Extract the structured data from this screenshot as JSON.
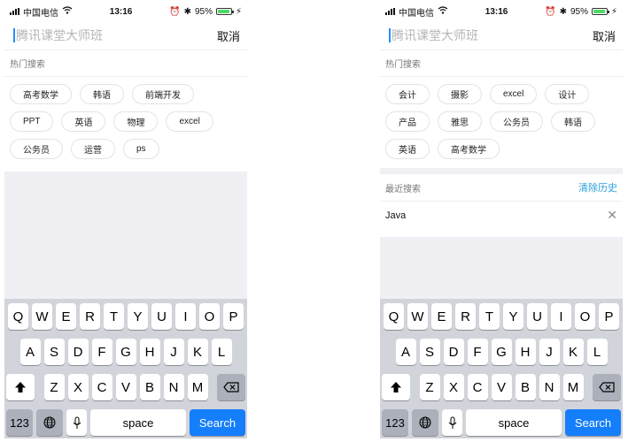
{
  "left": {
    "status": {
      "carrier": "中国电信",
      "time": "13:16",
      "battery": "95%"
    },
    "search": {
      "placeholder": "腾讯课堂大师班",
      "cancel": "取消"
    },
    "hot": {
      "title": "热门搜索",
      "tags": [
        "高考数学",
        "韩语",
        "前端开发",
        "PPT",
        "英语",
        "物理",
        "excel",
        "公务员",
        "运营",
        "ps"
      ]
    },
    "keyboard": {
      "row1": [
        "Q",
        "W",
        "E",
        "R",
        "T",
        "Y",
        "U",
        "I",
        "O",
        "P"
      ],
      "row2": [
        "A",
        "S",
        "D",
        "F",
        "G",
        "H",
        "J",
        "K",
        "L"
      ],
      "row3": [
        "Z",
        "X",
        "C",
        "V",
        "B",
        "N",
        "M"
      ],
      "numbers": "123",
      "space": "space",
      "search": "Search"
    }
  },
  "right": {
    "status": {
      "carrier": "中国电信",
      "time": "13:16",
      "battery": "95%"
    },
    "search": {
      "placeholder": "腾讯课堂大师班",
      "cancel": "取消"
    },
    "hot": {
      "title": "热门搜索",
      "tags": [
        "会计",
        "摄影",
        "excel",
        "设计",
        "产品",
        "雅思",
        "公务员",
        "韩语",
        "英语",
        "高考数学"
      ]
    },
    "recent": {
      "title": "最近搜索",
      "clear": "清除历史",
      "items": [
        "Java"
      ]
    },
    "keyboard": {
      "row1": [
        "Q",
        "W",
        "E",
        "R",
        "T",
        "Y",
        "U",
        "I",
        "O",
        "P"
      ],
      "row2": [
        "A",
        "S",
        "D",
        "F",
        "G",
        "H",
        "J",
        "K",
        "L"
      ],
      "row3": [
        "Z",
        "X",
        "C",
        "V",
        "B",
        "N",
        "M"
      ],
      "numbers": "123",
      "space": "space",
      "search": "Search"
    }
  },
  "icons": {
    "wifi": "wifi-icon",
    "shift": "shift-icon",
    "backspace": "backspace-icon",
    "globe": "globe-icon",
    "mic": "mic-icon",
    "close": "close-icon"
  },
  "colors": {
    "accent": "#157efb",
    "link": "#2a9fdc",
    "battery": "#4cd964",
    "gray_bg": "#efeff4"
  }
}
